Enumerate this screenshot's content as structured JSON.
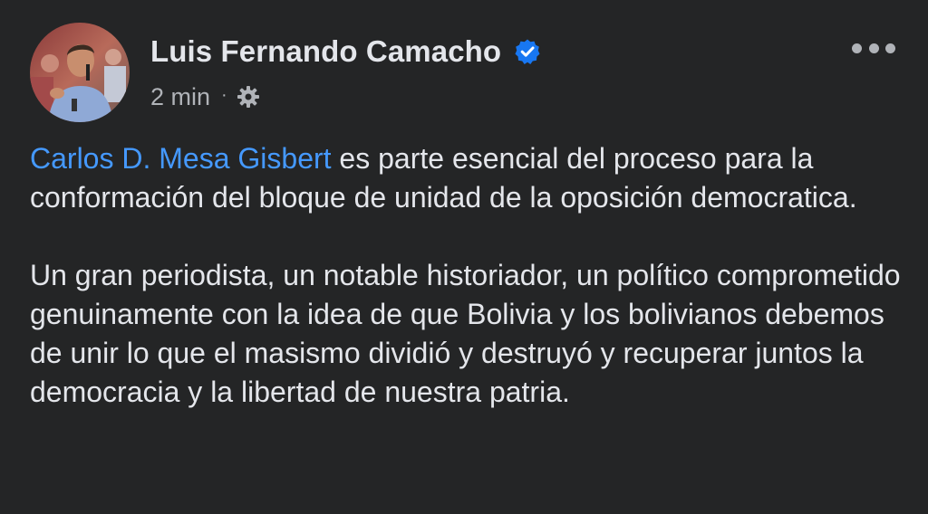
{
  "post": {
    "author": {
      "name": "Luis Fernando Camacho",
      "verified": true,
      "avatar_icon": "profile-photo"
    },
    "meta": {
      "time": "2 min",
      "separator": "·",
      "privacy_icon": "gear-icon"
    },
    "more_icon": "more-options-icon",
    "body": {
      "paragraph1": {
        "mention": "Carlos D. Mesa Gisbert",
        "text": " es parte esencial del proceso para la conformación del bloque de unidad de la oposición democratica."
      },
      "paragraph2": "Un gran periodista, un notable historiador, un político comprometido genuinamente con la idea de que Bolivia y los bolivianos debemos de unir lo que el masismo dividió y destruyó y recuperar juntos la democracia y la libertad de nuestra patria."
    }
  },
  "colors": {
    "background": "#242526",
    "primary_text": "#e4e6eb",
    "secondary_text": "#b0b3b8",
    "mention": "#4599ff",
    "verified": "#1877f2"
  }
}
